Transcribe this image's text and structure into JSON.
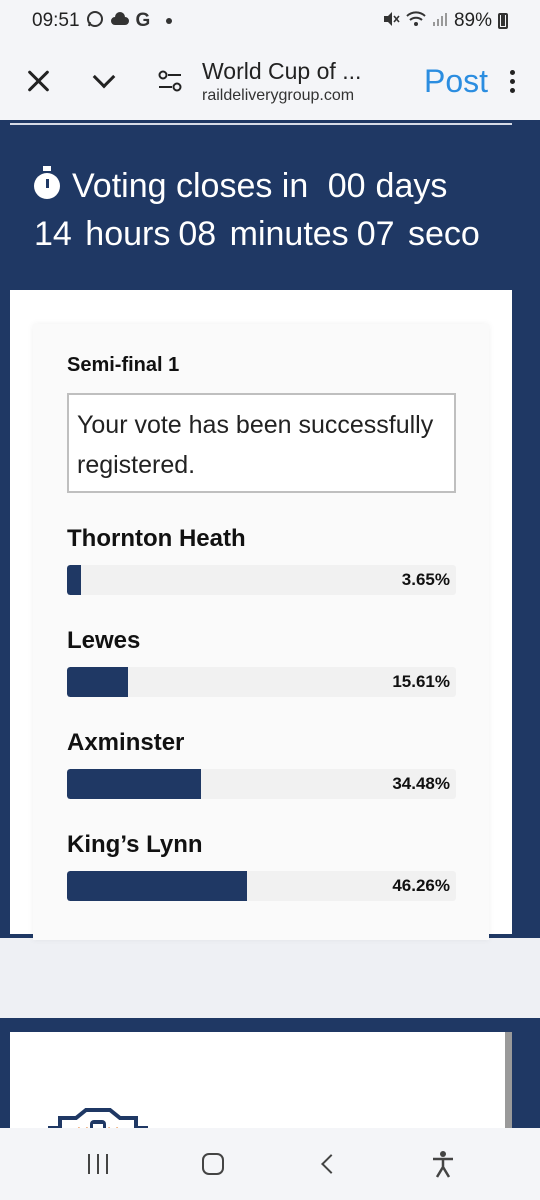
{
  "status_bar": {
    "time": "09:51",
    "battery": "89%",
    "left_icons": [
      "whatsapp-icon",
      "cloud-icon",
      "google-icon"
    ],
    "right_icons": [
      "mute-icon",
      "wifi-icon",
      "signal-icon",
      "battery-icon"
    ]
  },
  "toolbar": {
    "title": "World Cup of ...",
    "url": "raildeliverygroup.com",
    "post_label": "Post"
  },
  "countdown": {
    "prefix": "Voting closes in",
    "days": "00",
    "days_label": "days",
    "hours": "14",
    "hours_label": "hours",
    "minutes": "08",
    "minutes_label": "minutes",
    "seconds": "07",
    "seconds_label": "seco"
  },
  "poll": {
    "title": "Semi-final 1",
    "message": "Your vote has been successfully registered.",
    "options": [
      {
        "name": "Thornton Heath",
        "percent_label": "3.65%",
        "percent": 3.65
      },
      {
        "name": "Lewes",
        "percent_label": "15.61%",
        "percent": 15.61
      },
      {
        "name": "Axminster",
        "percent_label": "34.48%",
        "percent": 34.48
      },
      {
        "name": "King’s Lynn",
        "percent_label": "46.26%",
        "percent": 46.26
      }
    ]
  },
  "colors": {
    "brand_navy": "#1f3864",
    "post_blue": "#2b8de0",
    "logo_orange": "#e8873a"
  }
}
